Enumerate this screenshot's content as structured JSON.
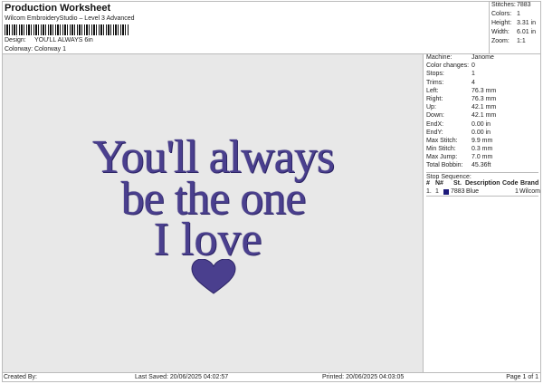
{
  "header": {
    "title": "Production Worksheet",
    "software": "Wilcom EmbroideryStudio – Level 3 Advanced",
    "design_label": "Design:",
    "design": "YOU'LL ALWAYS 6in",
    "colorway_label": "Colorway:",
    "colorway": "Colorway 1"
  },
  "stats": [
    {
      "k": "Stitches:",
      "v": "7883"
    },
    {
      "k": "Colors:",
      "v": "1"
    },
    {
      "k": "Height:",
      "v": "3.31 in"
    },
    {
      "k": "Width:",
      "v": "6.01 in"
    },
    {
      "k": "Zoom:",
      "v": "1:1"
    }
  ],
  "design_text": [
    "You'll always",
    "be the one",
    "I love"
  ],
  "thread_color": "#3f3585",
  "machine": [
    {
      "k": "Machine:",
      "v": "Janome"
    },
    {
      "k": "Color changes:",
      "v": "0"
    },
    {
      "k": "Stops:",
      "v": "1"
    },
    {
      "k": "Trims:",
      "v": "4"
    },
    {
      "k": "Left:",
      "v": "76.3 mm"
    },
    {
      "k": "Right:",
      "v": "76.3 mm"
    },
    {
      "k": "Up:",
      "v": "42.1 mm"
    },
    {
      "k": "Down:",
      "v": "42.1 mm"
    },
    {
      "k": "EndX:",
      "v": "0.00 in"
    },
    {
      "k": "EndY:",
      "v": "0.00 in"
    },
    {
      "k": "Max Stitch:",
      "v": "9.9 mm"
    },
    {
      "k": "Min Stitch:",
      "v": "0.3 mm"
    },
    {
      "k": "Max Jump:",
      "v": "7.0 mm"
    },
    {
      "k": "Total Bobbin:",
      "v": "45.36ft"
    }
  ],
  "stop_sequence": {
    "title": "Stop Sequence:",
    "headers": [
      "#",
      "N#",
      "St.",
      "Description",
      "Code",
      "Brand"
    ],
    "rows": [
      {
        "num": "1.",
        "n": "1",
        "st": "7883",
        "desc": "Blue",
        "code": "1",
        "brand": "Wilcom"
      }
    ]
  },
  "footer": {
    "created": "Created By:",
    "saved": "Last Saved: 20/06/2025 04:02:57",
    "printed": "Printed: 20/06/2025 04:03:05",
    "page": "Page 1 of 1"
  }
}
